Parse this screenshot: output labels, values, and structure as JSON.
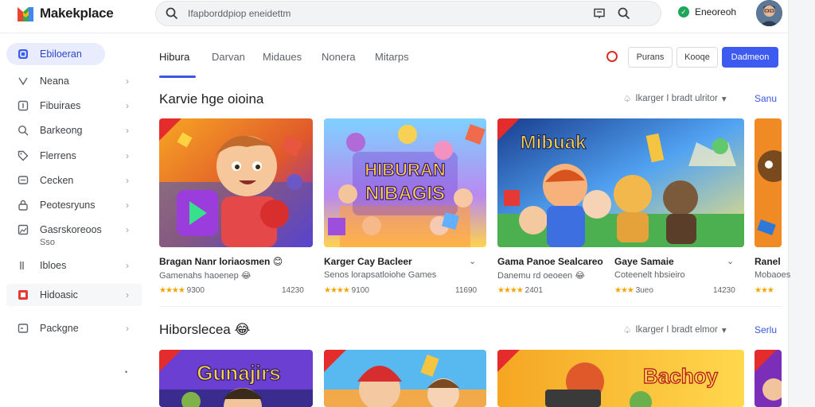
{
  "app": {
    "name": "Makekplace"
  },
  "search": {
    "placeholder": "Ifapborddpiop eneidettm"
  },
  "account": {
    "name": "Eneoreoh"
  },
  "sidebar": {
    "items": [
      {
        "label": "Ebiloeran",
        "icon": "store-icon"
      },
      {
        "label": "Neana",
        "icon": "gamepad-icon"
      },
      {
        "label": "Fibuiraes",
        "icon": "book-icon"
      },
      {
        "label": "Barkeong",
        "icon": "search-icon"
      },
      {
        "label": "Flerrens",
        "icon": "tag-icon"
      },
      {
        "label": "Cecken",
        "icon": "message-icon"
      },
      {
        "label": "Peotesryuns",
        "icon": "lock-icon"
      },
      {
        "label": "Gasrskoreoos",
        "sub": "Sso",
        "icon": "image-icon"
      },
      {
        "label": "Ibloes",
        "icon": "list-icon"
      },
      {
        "label": "Hidoasic",
        "icon": "game-icon"
      },
      {
        "label": "Packgne",
        "icon": "box-icon"
      }
    ]
  },
  "tabs": [
    "Hibura",
    "Darvan",
    "Midaues",
    "Nonera",
    "Mitarps"
  ],
  "toolbar": {
    "btn1": "Purans",
    "btn2": "Kooqe",
    "btn3": "Dadmeon"
  },
  "section1": {
    "title": "Karvie hge oioina",
    "meta": "Ikarger I bradt ulritor",
    "link": "Sanu",
    "cards": [
      {
        "title": "Bragan Nanr loriaosmen",
        "emoji": "😊",
        "sub": "Gamenahs haoenep",
        "emoji2": "😂",
        "rating": "9300",
        "count": "14230"
      },
      {
        "title": "Karger Cay Bacleer",
        "sub": "Senos lorapsatloiohe Games",
        "rating": "9100",
        "count": "11690"
      },
      {
        "title": "Gama Panoe Sealcareo",
        "sub": "Danemu rd oeoeen",
        "emoji2": "😂",
        "rating": "2401",
        "count": ""
      },
      {
        "title": "Gaye Samaie",
        "sub": "Coteenelt hbsieiro",
        "rating": "3ueo",
        "count": "14230"
      },
      {
        "title": "Ranel",
        "sub": "Mobaoes",
        "rating": "",
        "count": ""
      }
    ],
    "art_titles": [
      "HIBURAN",
      "NIBAGIS",
      "Mibuak"
    ]
  },
  "section2": {
    "title": "Hiborslecea",
    "meta": "Ikarger I bradt elmor",
    "link": "Serlu",
    "art_titles": [
      "Gunajirs",
      "Bachoy"
    ]
  }
}
